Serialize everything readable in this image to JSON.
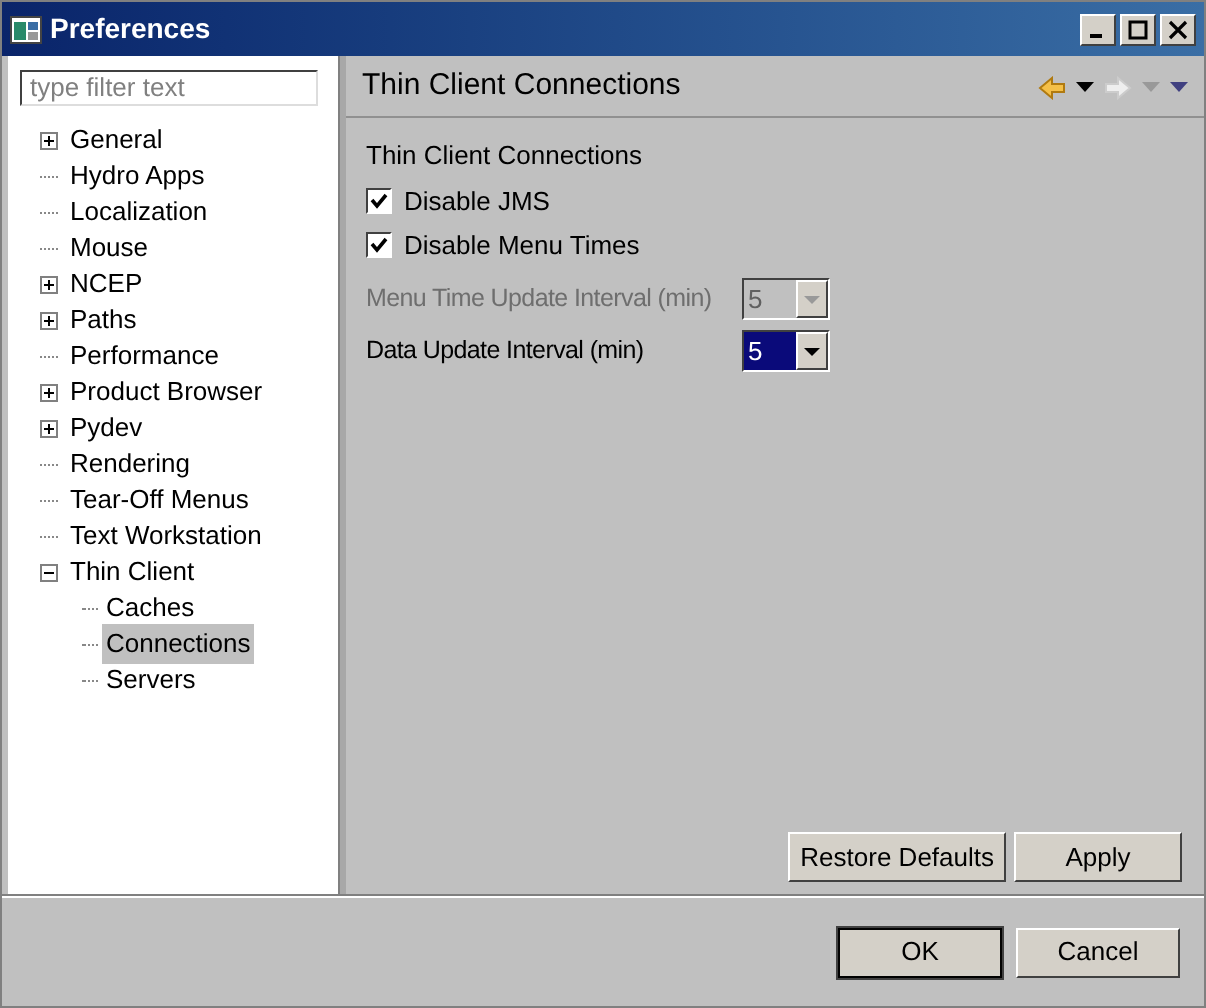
{
  "window": {
    "title": "Preferences"
  },
  "filter": {
    "placeholder": "type filter text"
  },
  "tree": [
    {
      "label": "General",
      "kind": "group",
      "expanded": false,
      "selected": false
    },
    {
      "label": "Hydro Apps",
      "kind": "page",
      "selected": false
    },
    {
      "label": "Localization",
      "kind": "page",
      "selected": false
    },
    {
      "label": "Mouse",
      "kind": "page",
      "selected": false
    },
    {
      "label": "NCEP",
      "kind": "group",
      "expanded": false,
      "selected": false
    },
    {
      "label": "Paths",
      "kind": "group",
      "expanded": false,
      "selected": false
    },
    {
      "label": "Performance",
      "kind": "page",
      "selected": false
    },
    {
      "label": "Product Browser",
      "kind": "group",
      "expanded": false,
      "selected": false
    },
    {
      "label": "Pydev",
      "kind": "group",
      "expanded": false,
      "selected": false
    },
    {
      "label": "Rendering",
      "kind": "page",
      "selected": false
    },
    {
      "label": "Tear-Off Menus",
      "kind": "page",
      "selected": false
    },
    {
      "label": "Text Workstation",
      "kind": "page",
      "selected": false
    },
    {
      "label": "Thin Client",
      "kind": "group",
      "expanded": true,
      "selected": false,
      "children": [
        {
          "label": "Caches",
          "selected": false
        },
        {
          "label": "Connections",
          "selected": true
        },
        {
          "label": "Servers",
          "selected": false
        }
      ]
    }
  ],
  "page": {
    "title": "Thin Client Connections",
    "section": "Thin Client Connections",
    "checkboxes": [
      {
        "label": "Disable JMS",
        "checked": true
      },
      {
        "label": "Disable Menu Times",
        "checked": true
      }
    ],
    "dropdowns": [
      {
        "label": "Menu Time Update Interval (min)",
        "value": "5",
        "disabled": true,
        "focused": false
      },
      {
        "label": "Data Update Interval (min)",
        "value": "5",
        "disabled": false,
        "focused": true
      }
    ],
    "buttons": [
      "Restore Defaults",
      "Apply"
    ]
  },
  "footer_buttons": [
    {
      "label": "OK",
      "default": true
    },
    {
      "label": "Cancel",
      "default": false
    }
  ]
}
